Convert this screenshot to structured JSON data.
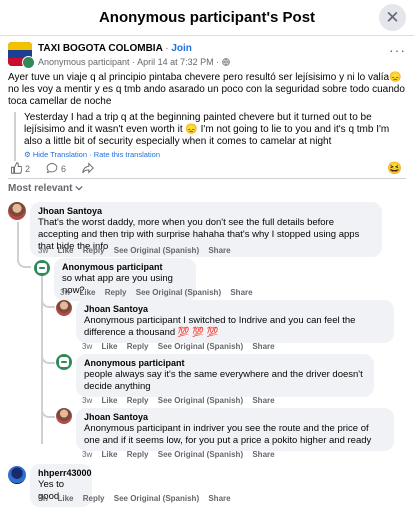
{
  "header": {
    "title": "Anonymous participant's Post",
    "close_icon": "close-icon"
  },
  "post": {
    "group_name": "TAXI BOGOTA COLOMBIA",
    "join_separator": "·",
    "join_label": "Join",
    "author": "Anonymous participant",
    "meta_sep": "·",
    "date": "April 14 at 7:32 PM",
    "visibility_sep": "·",
    "visibility_icon": "globe-icon",
    "text": "Ayer tuve un viaje q al principio pintaba chevere pero resultó ser lejísisimo y ni lo valía😞 no les voy a mentir y es q tmb ando asarado un poco con la seguridad sobre todo cuando toca camellar de noche",
    "translation": "Yesterday I had a trip q at the beginning painted chevere but it turned out to be lejísisimo and it wasn't even worth it 😞 I'm not going to lie to you and it's q tmb I'm also a little bit of security especially when it comes to camelar at night",
    "hide_translation": "Hide Translation",
    "link_sep": "·",
    "rate_translation": "Rate this translation"
  },
  "reactions": {
    "likes": "2",
    "comments": "6",
    "reaction_emoji": "😆"
  },
  "comments_filter": "Most relevant",
  "comments": [
    {
      "name": "Jhoan Santoya",
      "text": "That's the worst daddy, more when you don't see the full details before accepting and then trip with surprise hahaha that's why I stopped using apps that hide the info",
      "time": "3w",
      "like": "Like",
      "reply": "Reply",
      "see_original": "See Original (Spanish)",
      "share": "Share"
    },
    {
      "name": "Anonymous participant",
      "text": "so what app are you using now?",
      "time": "3w",
      "like": "Like",
      "reply": "Reply",
      "see_original": "See Original (Spanish)",
      "share": "Share"
    },
    {
      "name": "Jhoan Santoya",
      "text": "Anonymous participant I switched to Indrive and you can feel the difference a thousand 💯 💯 💯",
      "time": "3w",
      "like": "Like",
      "reply": "Reply",
      "see_original": "See Original (Spanish)",
      "share": "Share"
    },
    {
      "name": "Anonymous participant",
      "text": "people always say it's the same everywhere and the driver doesn't decide anything",
      "time": "3w",
      "like": "Like",
      "reply": "Reply",
      "see_original": "See Original (Spanish)",
      "share": "Share"
    },
    {
      "name": "Jhoan Santoya",
      "text": "Anonymous participant in indriver you see the route and the price of one and if it seems low, for you put a price a pokito higher and ready",
      "time": "3w",
      "like": "Like",
      "reply": "Reply",
      "see_original": "See Original (Spanish)",
      "share": "Share"
    },
    {
      "name": "hhperr43000",
      "text": "Yes to good",
      "time": "3w",
      "like": "Like",
      "reply": "Reply",
      "see_original": "See Original (Spanish)",
      "share": "Share"
    }
  ]
}
